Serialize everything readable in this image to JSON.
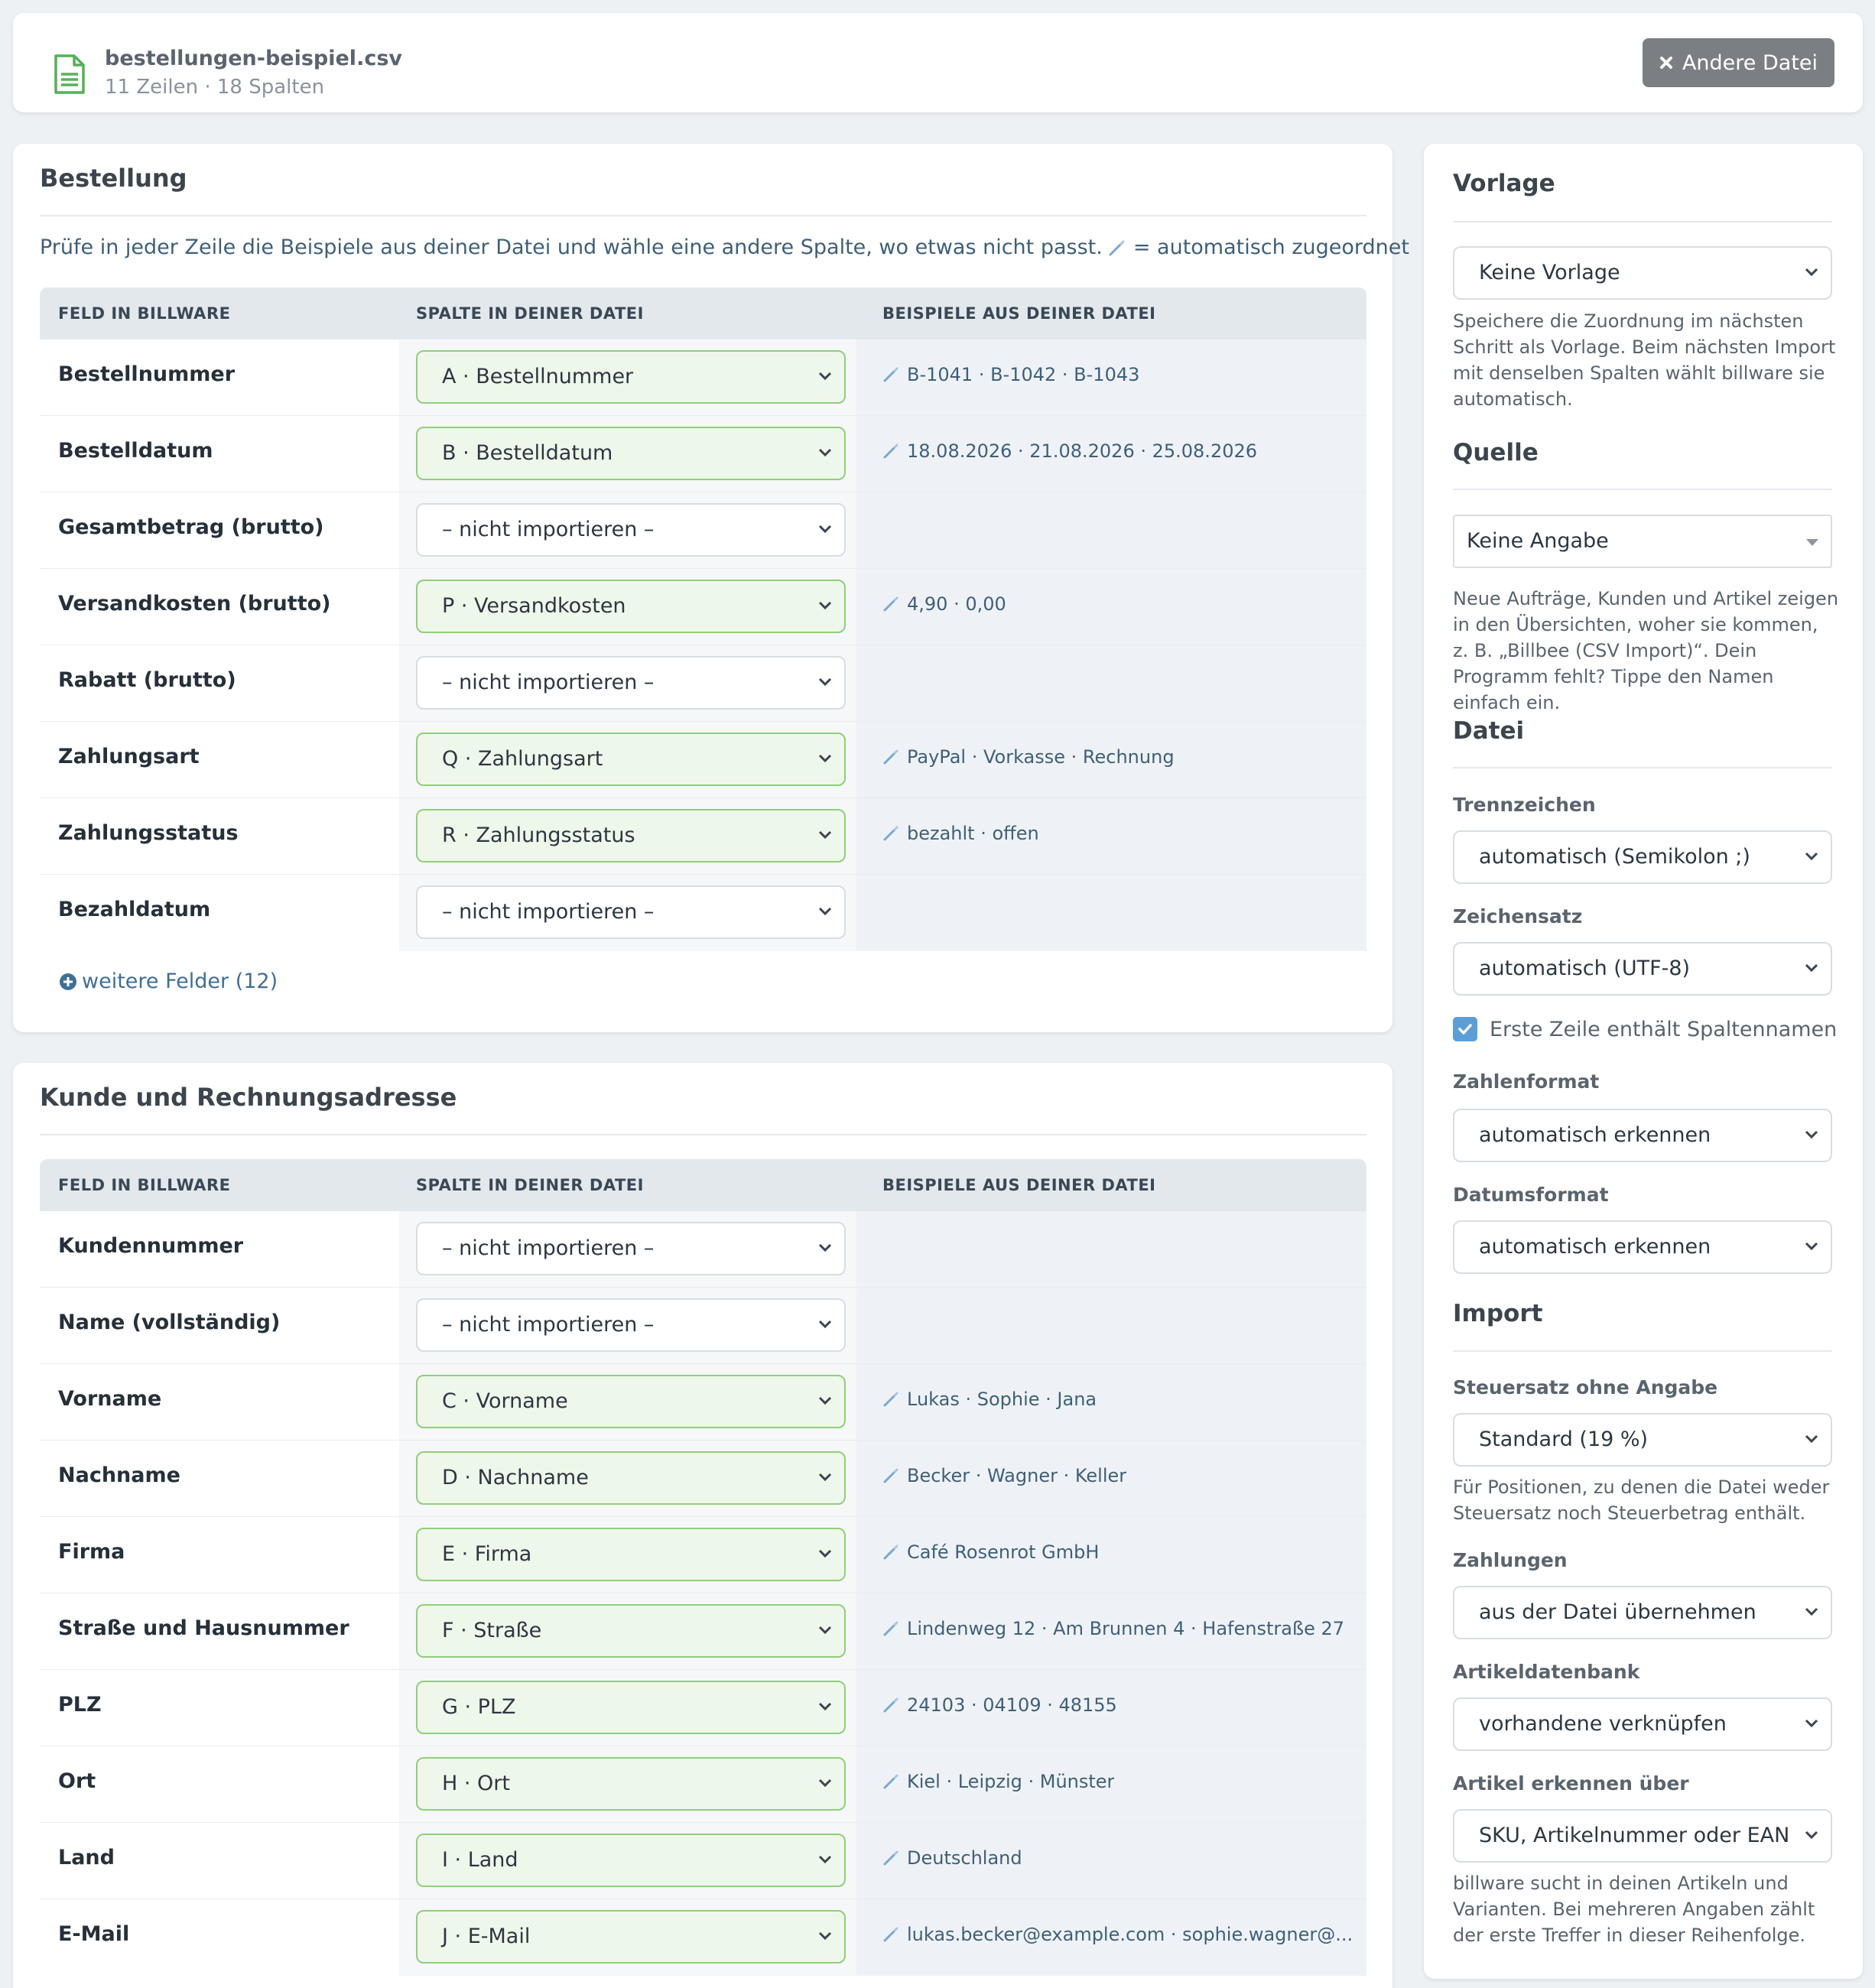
{
  "file": {
    "name": "bestellungen-beispiel.csv",
    "meta": "11 Zeilen · 18 Spalten",
    "other_file_label": "Andere Datei"
  },
  "colors": {
    "mapped_bg": "#eef8ea",
    "mapped_border": "#8fcf7a",
    "accent": "#5b9fd6",
    "button": "#7b7f83"
  },
  "table_headers": {
    "field": "FELD IN BILLWARE",
    "column": "SPALTE IN DEINER DATEI",
    "samples": "BEISPIELE AUS DEINER DATEI"
  },
  "bestellung": {
    "title": "Bestellung",
    "hint_before": "Prüfe in jeder Zeile die Beispiele aus deiner Datei und wähle eine andere Spalte, wo etwas nicht passt.",
    "hint_after": "= automatisch zugeordnet",
    "rows": [
      {
        "field": "Bestellnummer",
        "column": "A · Bestellnummer",
        "sample": "B-1041 · B-1042 · B-1043"
      },
      {
        "field": "Bestelldatum",
        "column": "B · Bestelldatum",
        "sample": "18.08.2026 · 21.08.2026 · 25.08.2026"
      },
      {
        "field": "Gesamtbetrag (brutto)",
        "column": "– nicht importieren –",
        "sample": ""
      },
      {
        "field": "Versandkosten (brutto)",
        "column": "P · Versandkosten",
        "sample": "4,90 · 0,00"
      },
      {
        "field": "Rabatt (brutto)",
        "column": "– nicht importieren –",
        "sample": ""
      },
      {
        "field": "Zahlungsart",
        "column": "Q · Zahlungsart",
        "sample": "PayPal · Vorkasse · Rechnung"
      },
      {
        "field": "Zahlungsstatus",
        "column": "R · Zahlungsstatus",
        "sample": "bezahlt · offen"
      },
      {
        "field": "Bezahldatum",
        "column": "– nicht importieren –",
        "sample": ""
      }
    ],
    "more_fields": "weitere Felder (12)"
  },
  "kunde": {
    "title": "Kunde und Rechnungsadresse",
    "rows": [
      {
        "field": "Kundennummer",
        "column": "– nicht importieren –",
        "sample": ""
      },
      {
        "field": "Name (vollständig)",
        "column": "– nicht importieren –",
        "sample": ""
      },
      {
        "field": "Vorname",
        "column": "C · Vorname",
        "sample": "Lukas · Sophie · Jana"
      },
      {
        "field": "Nachname",
        "column": "D · Nachname",
        "sample": "Becker · Wagner · Keller"
      },
      {
        "field": "Firma",
        "column": "E · Firma",
        "sample": "Café Rosenrot GmbH"
      },
      {
        "field": "Straße und Hausnummer",
        "column": "F · Straße",
        "sample": "Lindenweg 12 · Am Brunnen 4 · Hafenstraße 27"
      },
      {
        "field": "PLZ",
        "column": "G · PLZ",
        "sample": "24103 · 04109 · 48155"
      },
      {
        "field": "Ort",
        "column": "H · Ort",
        "sample": "Kiel · Leipzig · Münster"
      },
      {
        "field": "Land",
        "column": "I · Land",
        "sample": "Deutschland"
      },
      {
        "field": "E-Mail",
        "column": "J · E-Mail",
        "sample": "lukas.becker@example.com · sophie.wagner@..."
      }
    ]
  },
  "sidebar": {
    "vorlage": {
      "title": "Vorlage",
      "select": "Keine Vorlage",
      "help": "Speichere die Zuordnung im nächsten Schritt als Vorlage. Beim nächsten Import mit denselben Spalten wählt billware sie automatisch."
    },
    "quelle": {
      "title": "Quelle",
      "select": "Keine Angabe",
      "help": "Neue Aufträge, Kunden und Artikel zeigen in den Übersichten, woher sie kommen, z. B. „Billbee (CSV Import)“. Dein Programm fehlt? Tippe den Namen einfach ein."
    },
    "datei": {
      "title": "Datei",
      "trennzeichen_label": "Trennzeichen",
      "trennzeichen": "automatisch (Semikolon ;)",
      "zeichensatz_label": "Zeichensatz",
      "zeichensatz": "automatisch (UTF-8)",
      "first_row_label": "Erste Zeile enthält Spaltennamen",
      "zahlenformat_label": "Zahlenformat",
      "zahlenformat": "automatisch erkennen",
      "datumsformat_label": "Datumsformat",
      "datumsformat": "automatisch erkennen"
    },
    "import": {
      "title": "Import",
      "steuersatz_label": "Steuersatz ohne Angabe",
      "steuersatz": "Standard (19 %)",
      "steuersatz_help": "Für Positionen, zu denen die Datei weder Steuersatz noch Steuerbetrag enthält.",
      "zahlungen_label": "Zahlungen",
      "zahlungen": "aus der Datei übernehmen",
      "artikeldb_label": "Artikeldatenbank",
      "artikeldb": "vorhandene verknüpfen",
      "artikel_erkennen_label": "Artikel erkennen über",
      "artikel_erkennen": "SKU, Artikelnummer oder EAN",
      "artikel_help": "billware sucht in deinen Artikeln und Varianten. Bei mehreren Angaben zählt der erste Treffer in dieser Reihenfolge."
    }
  }
}
